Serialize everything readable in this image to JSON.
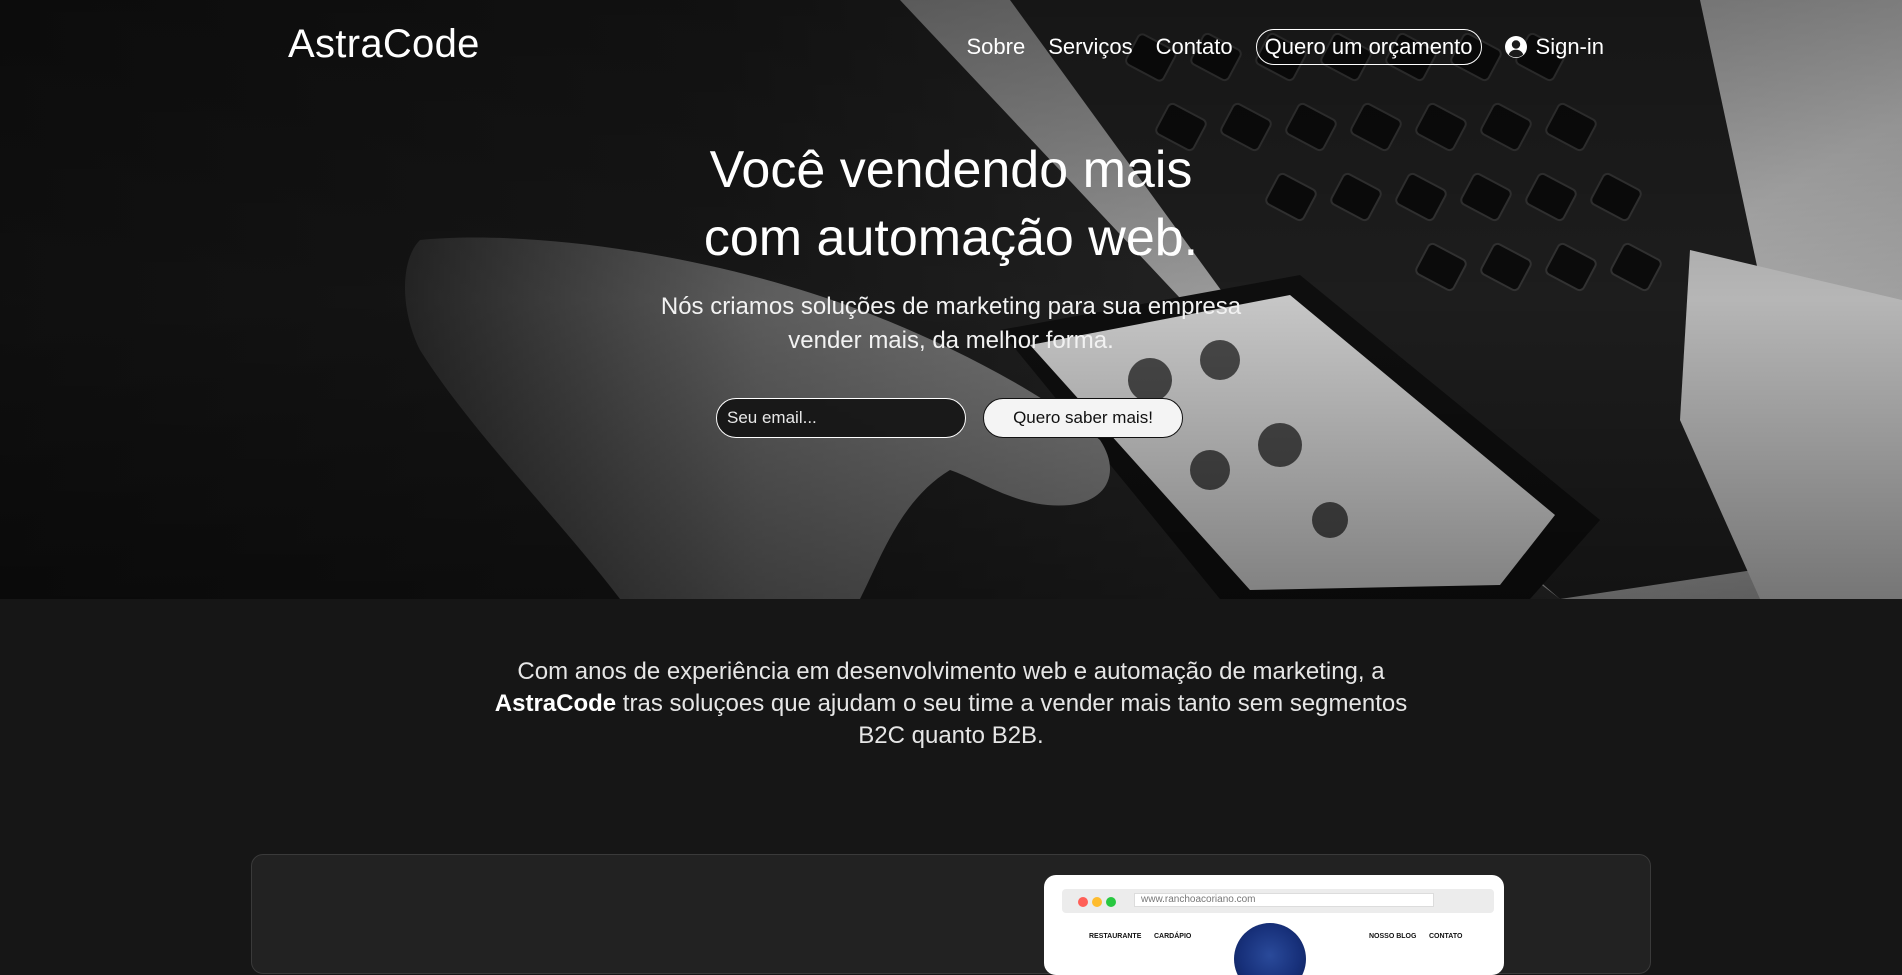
{
  "nav": {
    "brand": "AstraCode",
    "links": [
      "Sobre",
      "Serviços",
      "Contato"
    ],
    "cta": "Quero um orçamento",
    "signin": "Sign-in"
  },
  "hero": {
    "title_lines": [
      "Você vendendo mais",
      "com automação web."
    ],
    "subtitle_lines": [
      "Nós criamos soluções de marketing para sua empresa",
      "vender mais, da melhor forma."
    ],
    "email_placeholder": "Seu email...",
    "submit_label": "Quero saber mais!"
  },
  "about": {
    "line1": "Com anos de experiência em desenvolvimento web e automação de marketing, a",
    "line2_brand": "AstraCode",
    "line2_rest": " tras soluçoes que ajudam o seu time a vender mais tanto sem segmentos",
    "line3": "B2C quanto B2B."
  },
  "showcase": {
    "url": "www.ranchoacoriano.com",
    "site_nav": [
      "RESTAURANTE",
      "CARDÁPIO",
      "NOSSO BLOG",
      "CONTATO"
    ]
  },
  "colors": {
    "background": "#161616",
    "card": "#222222",
    "button_light": "#f4f4f4"
  },
  "icons": {
    "signin": "user-circle-icon"
  }
}
